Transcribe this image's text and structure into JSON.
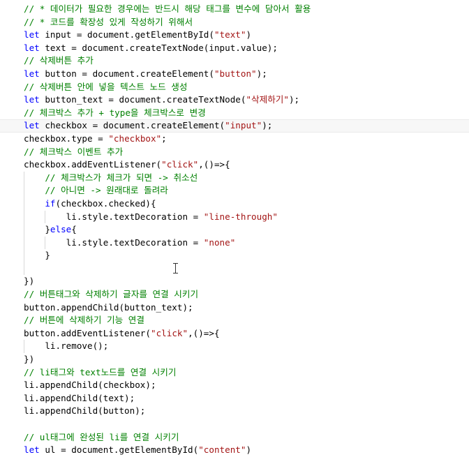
{
  "lines": [
    [
      {
        "t": "// * 데이터가 필요한 경우에는 반드시 해당 태그를 변수에 담아서 활용",
        "c": "cm"
      }
    ],
    [
      {
        "t": "// * 코드를 확장성 있게 작성하기 위해서",
        "c": "cm"
      }
    ],
    [
      {
        "t": "let",
        "c": "kw"
      },
      {
        "t": " input = document.getElementById(",
        "c": "fn"
      },
      {
        "t": "\"text\"",
        "c": "st"
      },
      {
        "t": ")",
        "c": "fn"
      }
    ],
    [
      {
        "t": "let",
        "c": "kw"
      },
      {
        "t": " text = document.createTextNode(input.value);",
        "c": "fn"
      }
    ],
    [
      {
        "t": "// 삭제버튼 추가",
        "c": "cm"
      }
    ],
    [
      {
        "t": "let",
        "c": "kw"
      },
      {
        "t": " button = document.createElement(",
        "c": "fn"
      },
      {
        "t": "\"button\"",
        "c": "st"
      },
      {
        "t": ");",
        "c": "fn"
      }
    ],
    [
      {
        "t": "// 삭제버튼 안에 넣을 텍스트 노드 생성",
        "c": "cm"
      }
    ],
    [
      {
        "t": "let",
        "c": "kw"
      },
      {
        "t": " button_text = document.createTextNode(",
        "c": "fn"
      },
      {
        "t": "\"삭제하기\"",
        "c": "st"
      },
      {
        "t": ");",
        "c": "fn"
      }
    ],
    [
      {
        "t": "// 체크박스 추가 + type을 체크박스로 변경",
        "c": "cm"
      }
    ],
    [
      {
        "t": "let",
        "c": "kw"
      },
      {
        "t": " checkbox = document.createElement(",
        "c": "fn"
      },
      {
        "t": "\"input\"",
        "c": "st"
      },
      {
        "t": ");",
        "c": "fn"
      }
    ],
    [
      {
        "t": "checkbox.type = ",
        "c": "fn"
      },
      {
        "t": "\"checkbox\"",
        "c": "st"
      },
      {
        "t": ";",
        "c": "fn"
      }
    ],
    [
      {
        "t": "// 체크박스 이벤트 추가",
        "c": "cm"
      }
    ],
    [
      {
        "t": "checkbox.addEventListener(",
        "c": "fn"
      },
      {
        "t": "\"click\"",
        "c": "st"
      },
      {
        "t": ",()=>{",
        "c": "fn"
      }
    ],
    [
      {
        "t": "    ",
        "c": "fn"
      },
      {
        "t": "// 체크박스가 체크가 되면 -> 취소선",
        "c": "cm"
      }
    ],
    [
      {
        "t": "    ",
        "c": "fn"
      },
      {
        "t": "// 아니면 -> 원래대로 돌려라",
        "c": "cm"
      }
    ],
    [
      {
        "t": "    ",
        "c": "fn"
      },
      {
        "t": "if",
        "c": "kw"
      },
      {
        "t": "(checkbox.checked){",
        "c": "fn"
      }
    ],
    [
      {
        "t": "        li.style.textDecoration = ",
        "c": "fn"
      },
      {
        "t": "\"line-through\"",
        "c": "st"
      }
    ],
    [
      {
        "t": "    }",
        "c": "fn"
      },
      {
        "t": "else",
        "c": "kw"
      },
      {
        "t": "{",
        "c": "fn"
      }
    ],
    [
      {
        "t": "        li.style.textDecoration = ",
        "c": "fn"
      },
      {
        "t": "\"none\"",
        "c": "st"
      }
    ],
    [
      {
        "t": "    }",
        "c": "fn"
      }
    ],
    [
      {
        "t": "",
        "c": "fn"
      }
    ],
    [
      {
        "t": "})",
        "c": "fn"
      }
    ],
    [
      {
        "t": "// 버튼태그와 삭제하기 글자를 연결 시키기",
        "c": "cm"
      }
    ],
    [
      {
        "t": "button.appendChild(button_text);",
        "c": "fn"
      }
    ],
    [
      {
        "t": "// 버튼에 삭제하기 기능 연결",
        "c": "cm"
      }
    ],
    [
      {
        "t": "button.addEventListener(",
        "c": "fn"
      },
      {
        "t": "\"click\"",
        "c": "st"
      },
      {
        "t": ",()=>{",
        "c": "fn"
      }
    ],
    [
      {
        "t": "    li.remove();",
        "c": "fn"
      }
    ],
    [
      {
        "t": "})",
        "c": "fn"
      }
    ],
    [
      {
        "t": "// li태그와 text노드를 연결 시키기",
        "c": "cm"
      }
    ],
    [
      {
        "t": "li.appendChild(checkbox);",
        "c": "fn"
      }
    ],
    [
      {
        "t": "li.appendChild(text);",
        "c": "fn"
      }
    ],
    [
      {
        "t": "li.appendChild(button);",
        "c": "fn"
      }
    ],
    [
      {
        "t": "",
        "c": "fn"
      }
    ],
    [
      {
        "t": "// ul태그에 완성된 li를 연결 시키기",
        "c": "cm"
      }
    ],
    [
      {
        "t": "let",
        "c": "kw"
      },
      {
        "t": " ul = document.getElementById(",
        "c": "fn"
      },
      {
        "t": "\"content\"",
        "c": "st"
      },
      {
        "t": ")",
        "c": "fn"
      }
    ]
  ],
  "current_line": 9,
  "colors": {
    "comment": "#008000",
    "keyword": "#0000ff",
    "string": "#a31515",
    "text": "#000000"
  }
}
